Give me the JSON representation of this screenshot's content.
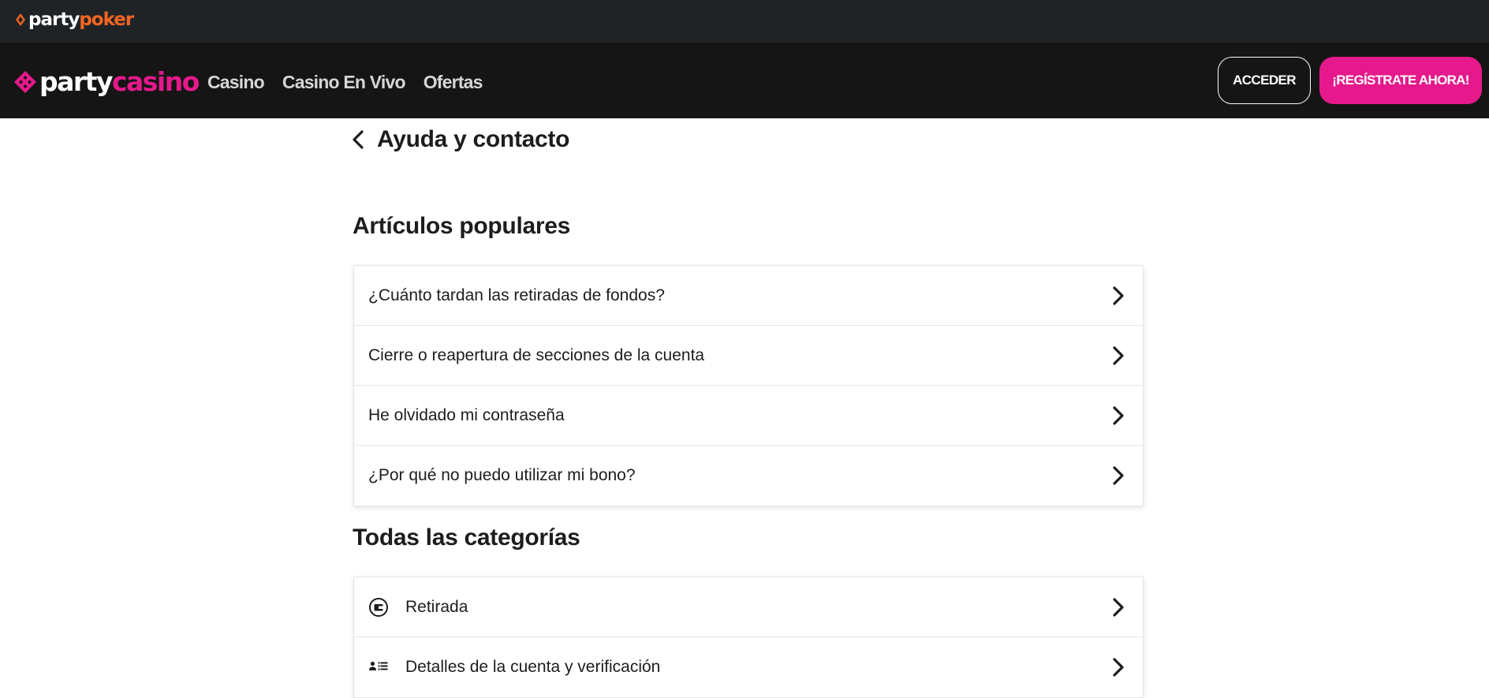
{
  "topbar": {
    "brand_white": "party",
    "brand_color": "poker"
  },
  "header": {
    "brand_white": "party",
    "brand_color": "casino",
    "nav": [
      {
        "label": "Casino"
      },
      {
        "label": "Casino En Vivo"
      },
      {
        "label": "Ofertas"
      }
    ],
    "login_label": "ACCEDER",
    "register_label": "¡REGÍSTRATE AHORA!"
  },
  "page": {
    "title": "Ayuda y contacto"
  },
  "popular": {
    "title": "Artículos populares",
    "items": [
      {
        "label": "¿Cuánto tardan las retiradas de fondos?"
      },
      {
        "label": "Cierre o reapertura de secciones de la cuenta"
      },
      {
        "label": "He olvidado mi contraseña"
      },
      {
        "label": "¿Por qué no puedo utilizar mi bono?"
      }
    ]
  },
  "categories": {
    "title": "Todas las categorías",
    "items": [
      {
        "label": "Retirada",
        "icon": "wallet-icon"
      },
      {
        "label": "Detalles de la cuenta y verificación",
        "icon": "account-details-icon"
      }
    ]
  },
  "colors": {
    "topbar_bg": "#1f2326",
    "header_bg": "#151515",
    "poker_orange": "#f26522",
    "casino_pink": "#e5198b"
  }
}
